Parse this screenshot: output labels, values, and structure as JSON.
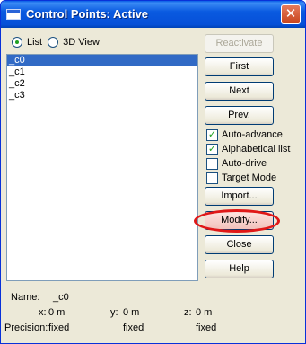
{
  "window": {
    "title": "Control Points: Active",
    "close_glyph": "✕"
  },
  "view_mode": {
    "options": [
      {
        "label": "List",
        "checked": true
      },
      {
        "label": "3D View",
        "checked": false
      }
    ]
  },
  "points": {
    "items": [
      "_c0",
      "_c1",
      "_c2",
      "_c3"
    ],
    "selected_index": 0
  },
  "buttons": {
    "reactivate": "Reactivate",
    "first": "First",
    "next": "Next",
    "prev": "Prev.",
    "import": "Import...",
    "modify": "Modify...",
    "close": "Close",
    "help": "Help"
  },
  "options": [
    {
      "label": "Auto-advance",
      "checked": true
    },
    {
      "label": "Alphabetical list",
      "checked": true
    },
    {
      "label": "Auto-drive",
      "checked": false
    },
    {
      "label": "Target Mode",
      "checked": false
    }
  ],
  "info": {
    "name_label": "Name:",
    "name_value": "_c0",
    "x_label": "x:",
    "x_value": "0 m",
    "y_label": "y:",
    "y_value": "0 m",
    "z_label": "z:",
    "z_value": "0 m",
    "precision_label": "Precision:",
    "precision_x": "fixed",
    "precision_y": "fixed",
    "precision_z": "fixed"
  }
}
